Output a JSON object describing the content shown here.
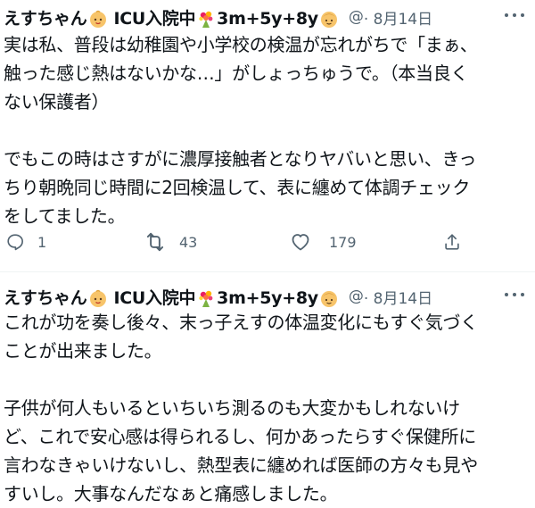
{
  "tweets": [
    {
      "author": {
        "name_part1": "えすちゃん",
        "name_part2": "ICU入院中",
        "name_part3": "3m+5y+8y",
        "baby_emoji": "baby-face-emoji",
        "flower_emoji": "bouquet-emoji",
        "child_emoji": "child-face-emoji"
      },
      "handle": "@",
      "date": "· 8月14日",
      "lines": [
        "実は私、普段は幼稚園や小学校の検温が忘れがちで「まぁ、",
        "触った感じ熱はないかな…」がしょっちゅうで。（本当良く",
        "ない保護者）",
        "",
        "でもこの時はさすがに濃厚接触者となりヤバいと思い、きっ",
        "ちり朝晩同じ時間に2回検温して、表に纏めて体調チェック",
        "をしてました。"
      ],
      "actions": {
        "reply_count": "1",
        "retweet_count": "43",
        "like_count": "179"
      }
    },
    {
      "author": {
        "name_part1": "えすちゃん",
        "name_part2": "ICU入院中",
        "name_part3": "3m+5y+8y",
        "baby_emoji": "baby-face-emoji",
        "flower_emoji": "bouquet-emoji",
        "child_emoji": "child-face-emoji"
      },
      "handle": "@",
      "date": "· 8月14日",
      "lines": [
        "これが功を奏し後々、末っ子えすの体温変化にもすぐ気づく",
        "ことが出来ました。",
        "",
        "子供が何人もいるといちいち測るのも大変かもしれないけ",
        "ど、これで安心感は得られるし、何かあったらすぐ保健所に",
        "言わなきゃいけないし、熱型表に纏めれば医師の方々も見や",
        "すいし。大事なんだなぁと痛感しました。"
      ]
    }
  ],
  "icons": {
    "more": "more-options-icon",
    "reply": "reply-icon",
    "retweet": "retweet-icon",
    "like": "like-icon",
    "share": "share-icon"
  },
  "colors": {
    "text": "#0f1419",
    "secondary": "#536471",
    "divider": "#eff3f4"
  }
}
